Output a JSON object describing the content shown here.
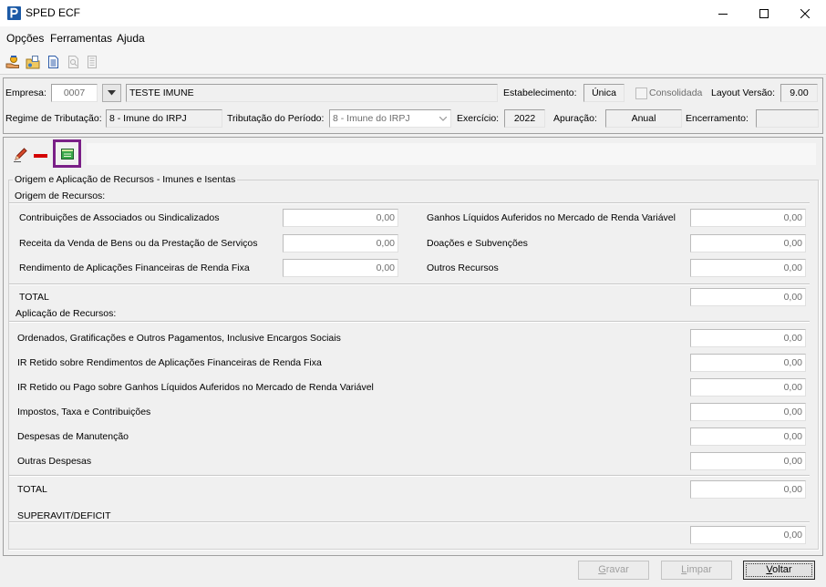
{
  "window": {
    "title": "SPED ECF"
  },
  "menu": {
    "items": [
      "Opções",
      "Ferramentas",
      "Ajuda"
    ]
  },
  "toolbar": {
    "icons": [
      {
        "icon": "hand-coin-icon",
        "enabled": true
      },
      {
        "icon": "folder-settings-icon",
        "enabled": true
      },
      {
        "icon": "document-icon",
        "enabled": true
      },
      {
        "icon": "document-search-icon",
        "enabled": false
      },
      {
        "icon": "document-list-icon",
        "enabled": false
      }
    ]
  },
  "header": {
    "empresa": {
      "label": "Empresa:",
      "code": "0007",
      "name": "TESTE IMUNE"
    },
    "estabelecimento": {
      "label": "Estabelecimento:",
      "value": "Única"
    },
    "consolidada": {
      "label": "Consolidada",
      "checked": false,
      "enabled": false
    },
    "layout_versao": {
      "label": "Layout Versão:",
      "value": "9.00"
    },
    "regime_tributacao": {
      "label": "Regime de Tributação:",
      "value": "8 - Imune do IRPJ"
    },
    "tributacao_periodo": {
      "label": "Tributação do Período:",
      "value": "8 - Imune do IRPJ"
    },
    "exercicio": {
      "label": "Exercício:",
      "value": "2022"
    },
    "apuracao": {
      "label": "Apuração:",
      "value": "Anual"
    },
    "encerramento": {
      "label": "Encerramento:",
      "value": ""
    }
  },
  "panel_toolbar": {
    "icons": [
      {
        "icon": "pencil-icon",
        "enabled": true
      },
      {
        "icon": "minus-icon",
        "enabled": true
      },
      {
        "icon": "spreadsheet-icon",
        "enabled": true,
        "highlighted": true
      }
    ]
  },
  "form": {
    "group_title": "Origem e Aplicação de Recursos - Imunes e Isentas",
    "origem": {
      "title": "Origem de Recursos:",
      "left": [
        {
          "label": "Contribuições de Associados ou Sindicalizados",
          "value": "0,00"
        },
        {
          "label": "Receita da Venda de Bens ou da Prestação de Serviços",
          "value": "0,00"
        },
        {
          "label": "Rendimento de Aplicações Financeiras de Renda Fixa",
          "value": "0,00"
        }
      ],
      "right": [
        {
          "label": "Ganhos Líquidos Auferidos no Mercado de Renda Variável",
          "value": "0,00"
        },
        {
          "label": "Doações e Subvenções",
          "value": "0,00"
        },
        {
          "label": "Outros Recursos",
          "value": "0,00"
        }
      ],
      "total_label": "TOTAL",
      "total_value": "0,00"
    },
    "aplicacao": {
      "title": "Aplicação de Recursos:",
      "items": [
        {
          "label": "Ordenados, Gratificações e Outros Pagamentos, Inclusive Encargos Sociais",
          "value": "0,00"
        },
        {
          "label": "IR Retido sobre Rendimentos de Aplicações Financeiras de Renda Fixa",
          "value": "0,00"
        },
        {
          "label": "IR Retido ou Pago sobre Ganhos Líquidos Auferidos no Mercado de Renda Variável",
          "value": "0,00"
        },
        {
          "label": "Impostos, Taxa e Contribuições",
          "value": "0,00"
        },
        {
          "label": "Despesas de Manutenção",
          "value": "0,00"
        },
        {
          "label": "Outras Despesas",
          "value": "0,00"
        }
      ],
      "total_label": "TOTAL",
      "total_value": "0,00"
    },
    "superavit": {
      "label": "SUPERAVIT/DEFICIT",
      "value": "0,00"
    }
  },
  "buttons": {
    "gravar": {
      "label": "Gravar",
      "enabled": false
    },
    "limpar": {
      "label": "Limpar",
      "enabled": false
    },
    "voltar": {
      "label": "Voltar",
      "enabled": true,
      "focused": true
    }
  },
  "colors": {
    "highlight_box": "#7a1f87",
    "delete_red": "#d40000",
    "app_icon_blue": "#1c5aa6"
  }
}
